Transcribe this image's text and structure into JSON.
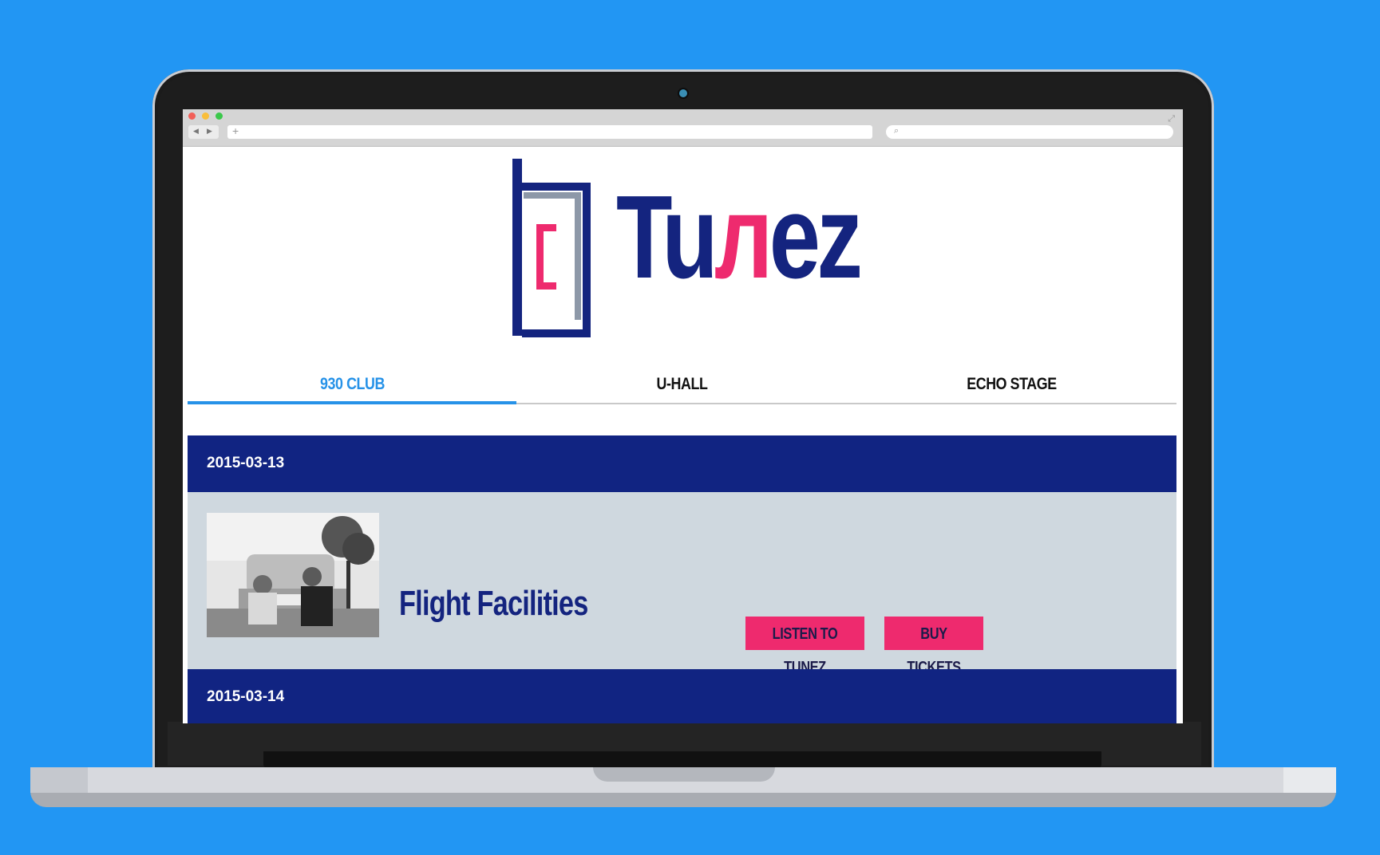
{
  "browser": {
    "nav_back": "◀",
    "nav_forward": "▶",
    "new_tab": "+",
    "search_icon": "search-icon",
    "expand_icon": "expand-icon"
  },
  "logo": {
    "text_prefix": "Tu",
    "text_note": "л",
    "text_suffix": "ez",
    "colors": {
      "navy": "#14247f",
      "pink": "#ee2a6e",
      "gray": "#8d98a8"
    }
  },
  "tabs": [
    {
      "label": "930 CLUB",
      "active": true
    },
    {
      "label": "U-HALL",
      "active": false
    },
    {
      "label": "ECHO STAGE",
      "active": false
    }
  ],
  "events": [
    {
      "date": "2015-03-13",
      "artist": "Flight Facilities",
      "listen_label": "LISTEN TO TUNEZ",
      "tickets_label": "BUY TICKETS"
    },
    {
      "date": "2015-03-14"
    }
  ],
  "colors": {
    "background": "#2296f3",
    "accent": "#2692e8",
    "date_bar": "#112482",
    "row_bg": "#cfd8df",
    "button": "#ee2a6e"
  }
}
